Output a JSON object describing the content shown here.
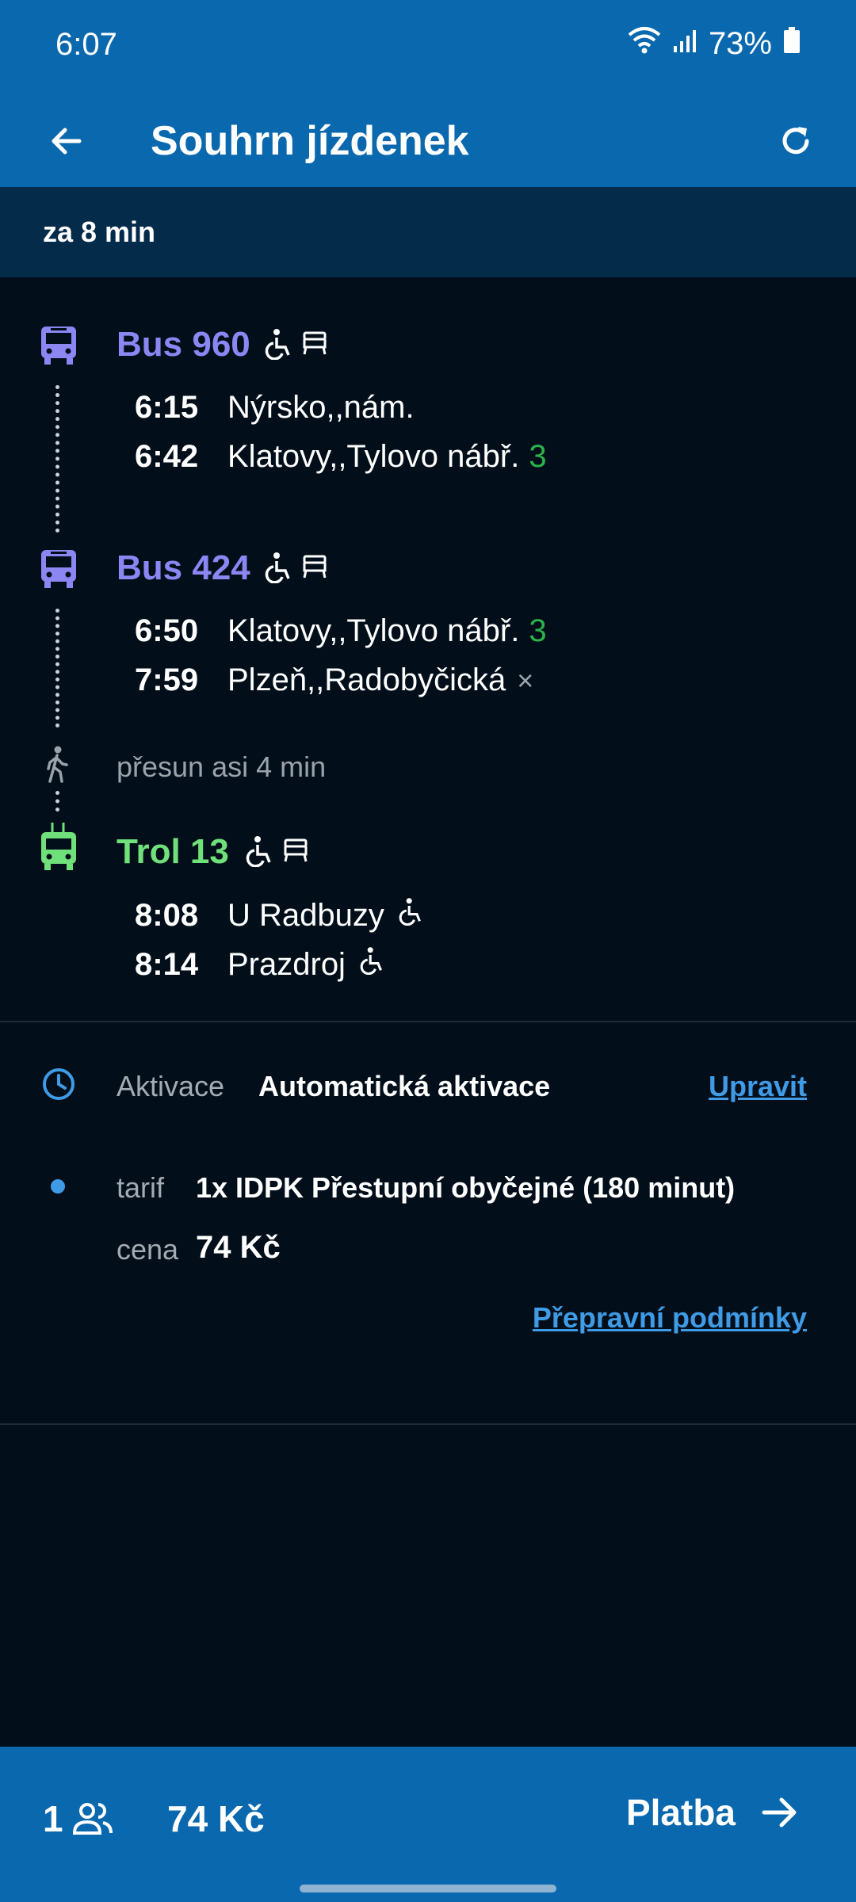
{
  "status_bar": {
    "time": "6:07",
    "battery": "73%"
  },
  "header": {
    "title": "Souhrn jízdenek"
  },
  "countdown": "za 8 min",
  "legs": [
    {
      "line": "Bus 960",
      "color": "#8b86f2",
      "icon": "bus-icon",
      "stops": [
        {
          "time": "6:15",
          "name": "Nýrsko,,nám.",
          "platform": ""
        },
        {
          "time": "6:42",
          "name": "Klatovy,,Tylovo nábř.",
          "platform": "3"
        }
      ]
    },
    {
      "line": "Bus 424",
      "color": "#8b86f2",
      "icon": "bus-icon",
      "stops": [
        {
          "time": "6:50",
          "name": "Klatovy,,Tylovo nábř.",
          "platform": "3"
        },
        {
          "time": "7:59",
          "name": "Plzeň,,Radobyčická",
          "platform": "×"
        }
      ]
    },
    {
      "line": "Trol 13",
      "color": "#6fe07a",
      "icon": "trolleybus-icon",
      "stops": [
        {
          "time": "8:08",
          "name": "U Radbuzy"
        },
        {
          "time": "8:14",
          "name": "Prazdroj"
        }
      ]
    }
  ],
  "transfer": {
    "text": "přesun asi 4 min"
  },
  "activation": {
    "label": "Aktivace",
    "value": "Automatická aktivace",
    "edit": "Upravit"
  },
  "ticket": {
    "tariff_label": "tarif",
    "tariff_value": "1x IDPK Přestupní obyčejné (180 minut)",
    "price_label": "cena",
    "price_value": "74 Kč",
    "terms_link": "Přepravní podmínky"
  },
  "footer": {
    "passengers": "1",
    "total": "74 Kč",
    "pay": "Platba"
  }
}
